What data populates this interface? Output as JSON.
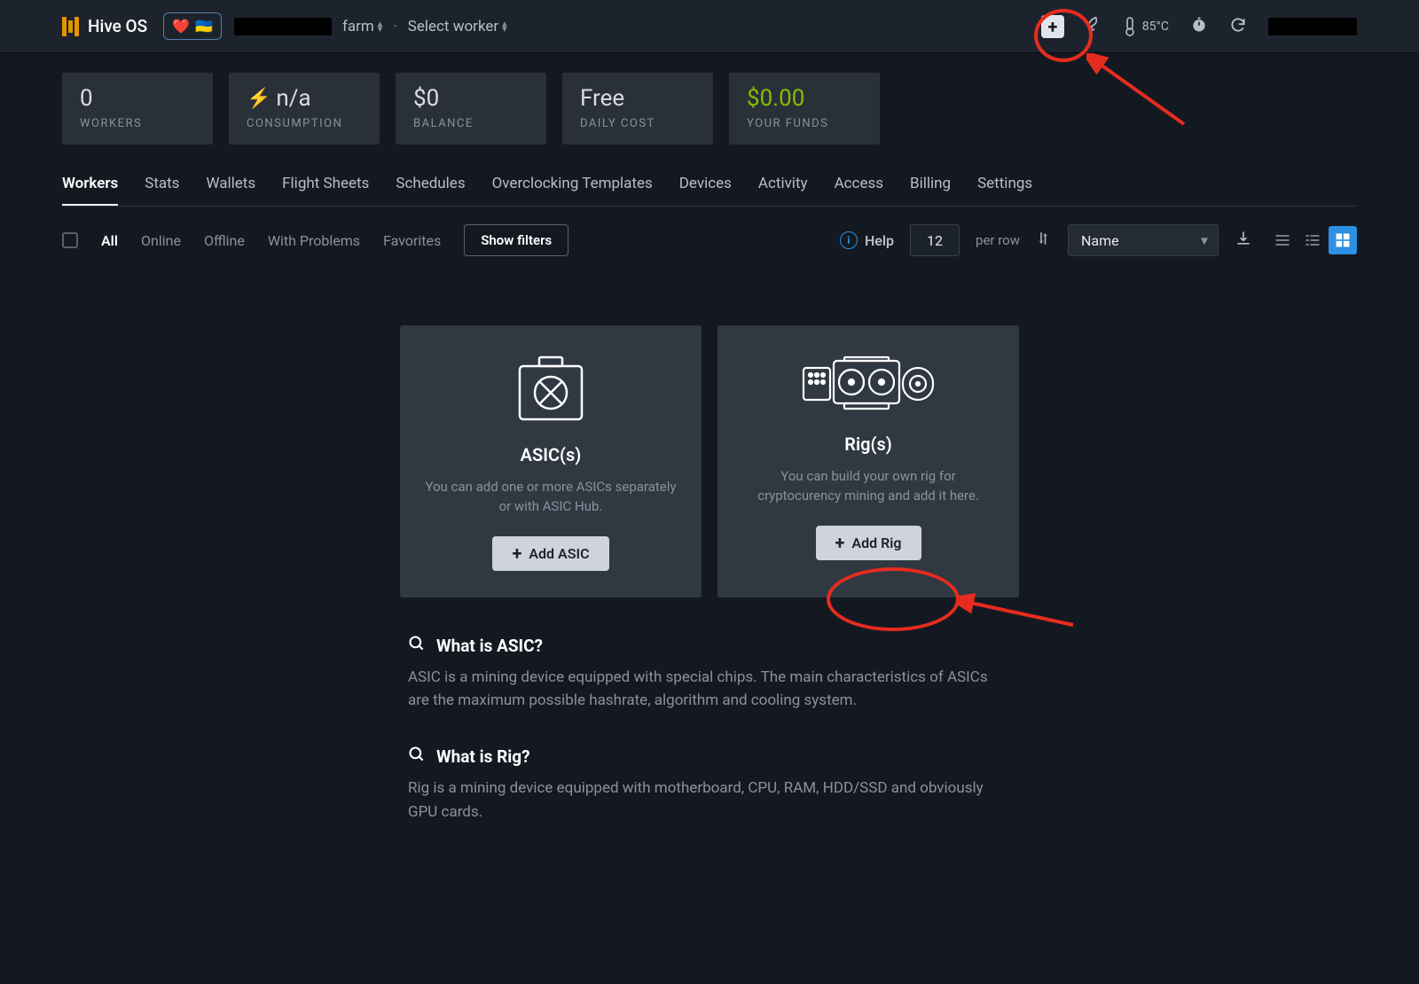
{
  "brand": "Hive OS",
  "flags": {
    "heart": "❤️",
    "ua": "🇺🇦"
  },
  "breadcrumb": {
    "farm_suffix": "farm",
    "worker_label": "Select worker"
  },
  "topbar_right": {
    "temp": "85°C"
  },
  "stats": [
    {
      "value": "0",
      "label": "WORKERS"
    },
    {
      "value": "n/a",
      "label": "CONSUMPTION",
      "prefix_icon": "bolt"
    },
    {
      "value": "$0",
      "label": "BALANCE"
    },
    {
      "value": "Free",
      "label": "DAILY COST"
    },
    {
      "value": "$0.00",
      "label": "YOUR FUNDS",
      "value_class": "green"
    }
  ],
  "tabs": [
    "Workers",
    "Stats",
    "Wallets",
    "Flight Sheets",
    "Schedules",
    "Overclocking Templates",
    "Devices",
    "Activity",
    "Access",
    "Billing",
    "Settings"
  ],
  "tabs_active": 0,
  "filter_links": [
    "All",
    "Online",
    "Offline",
    "With Problems",
    "Favorites"
  ],
  "filter_active": 0,
  "show_filters_label": "Show filters",
  "help_label": "Help",
  "per_row_value": "12",
  "per_row_label": "per row",
  "sort_value": "Name",
  "cards": {
    "asic": {
      "title": "ASIC(s)",
      "desc": "You can add one or more ASICs separately or with ASIC Hub.",
      "button": "Add ASIC"
    },
    "rig": {
      "title": "Rig(s)",
      "desc": "You can build your own rig for cryptocurency mining and add it here.",
      "button": "Add Rig"
    }
  },
  "info": {
    "asic": {
      "title": "What is ASIC?",
      "text": "ASIC is a mining device equipped with special chips. The main characteristics of ASICs are the maximum possible hashrate, algorithm and cooling system."
    },
    "rig": {
      "title": "What is Rig?",
      "text": "Rig is a mining device equipped with motherboard, CPU, RAM, HDD/SSD and obviously GPU cards."
    }
  }
}
